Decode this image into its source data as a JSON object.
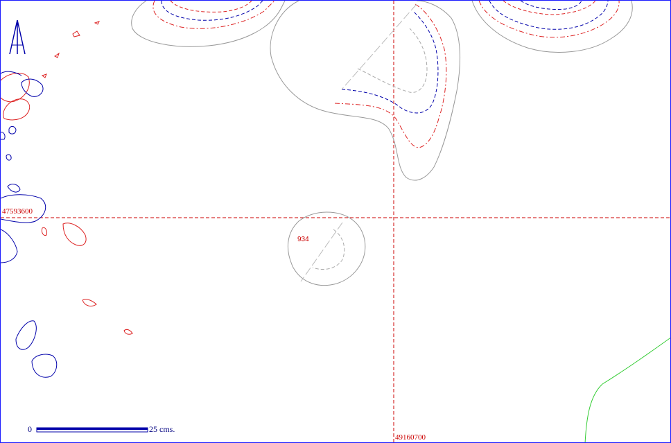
{
  "map": {
    "grid": {
      "northing_label": "47593600",
      "easting_label": "49160700"
    },
    "feature_label": "934",
    "scale_bar": {
      "start_label": "0",
      "end_label": "25 cms."
    },
    "north_arrow_icon": "north-arrow-icon",
    "colors": {
      "contour_index": "#0000aa",
      "contour_red": "#dd2222",
      "outline_gray": "#999999",
      "grid_red": "#cc0000",
      "boundary_green": "#33cc33",
      "frame_blue": "#1a1aff"
    }
  }
}
